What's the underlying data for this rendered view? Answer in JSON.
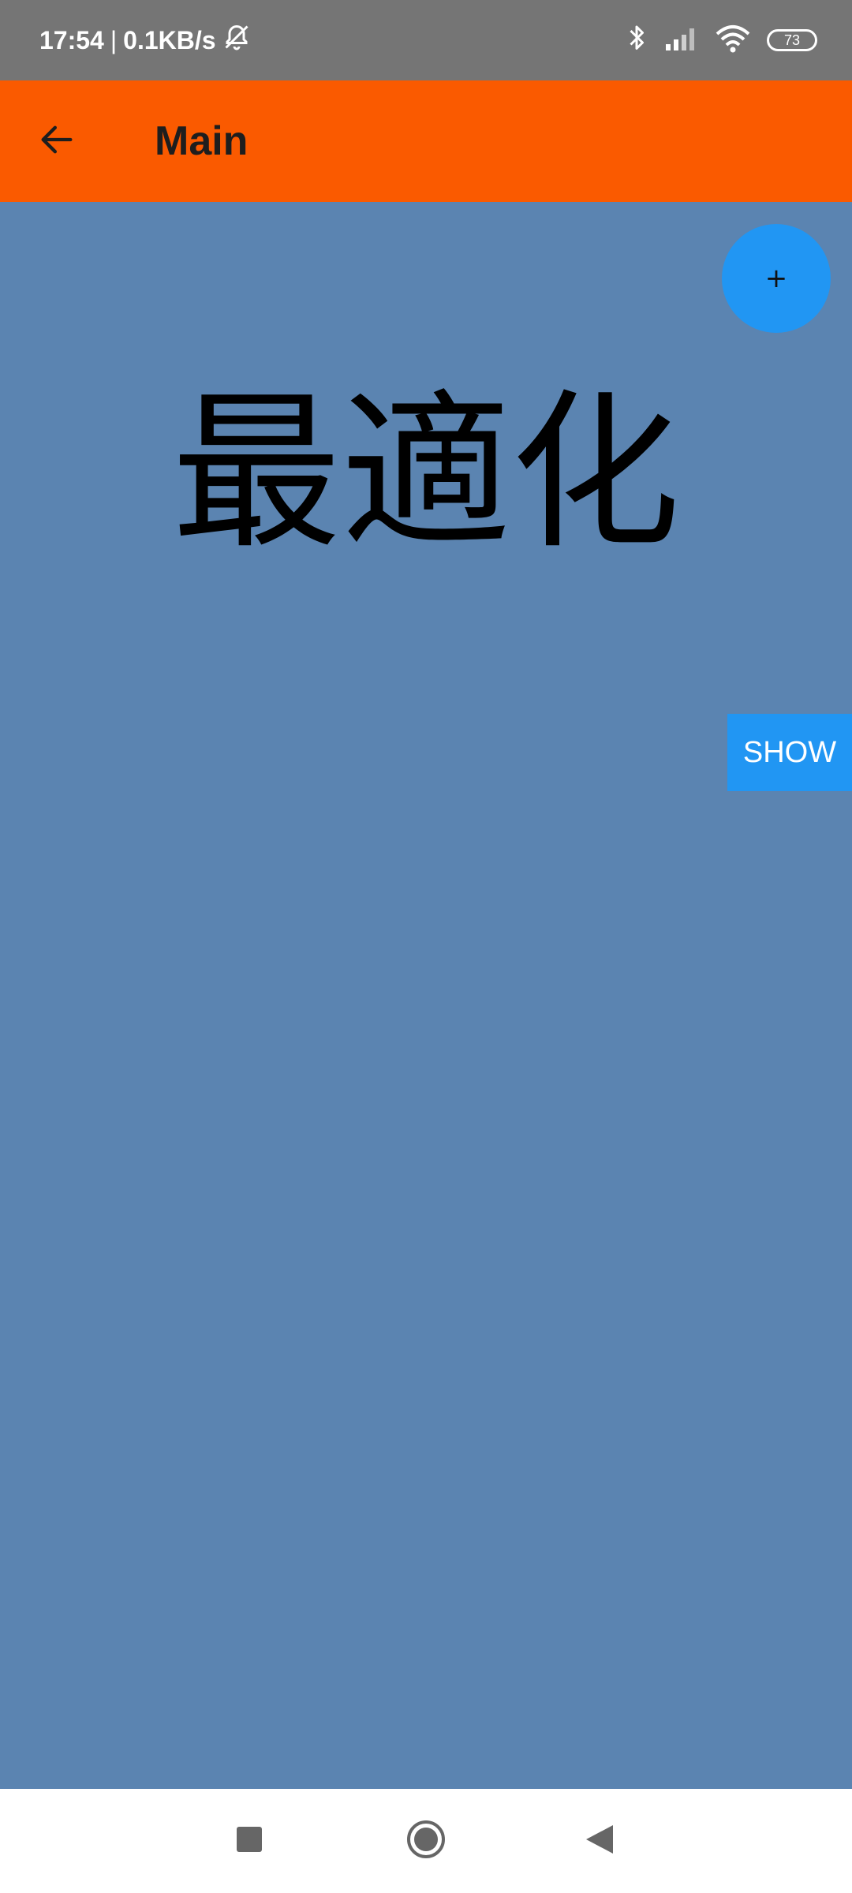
{
  "status_bar": {
    "time": "17:54",
    "separator": "|",
    "network_speed": "0.1KB/s",
    "battery_level": "73",
    "icons": [
      "mute-notifications-icon",
      "bluetooth-icon",
      "signal-icon",
      "wifi-icon",
      "battery-icon"
    ]
  },
  "app_bar": {
    "title": "Main",
    "back_icon": "arrow-back-icon",
    "background_color": "#fa5a00"
  },
  "main": {
    "heading": "最適化",
    "background_color": "#5b84b1",
    "fab_label": "+",
    "show_button_label": "SHOW",
    "accent_color": "#2196f3"
  },
  "nav_bar": {
    "icons": [
      "recent-apps-icon",
      "home-icon",
      "back-triangle-icon"
    ]
  }
}
